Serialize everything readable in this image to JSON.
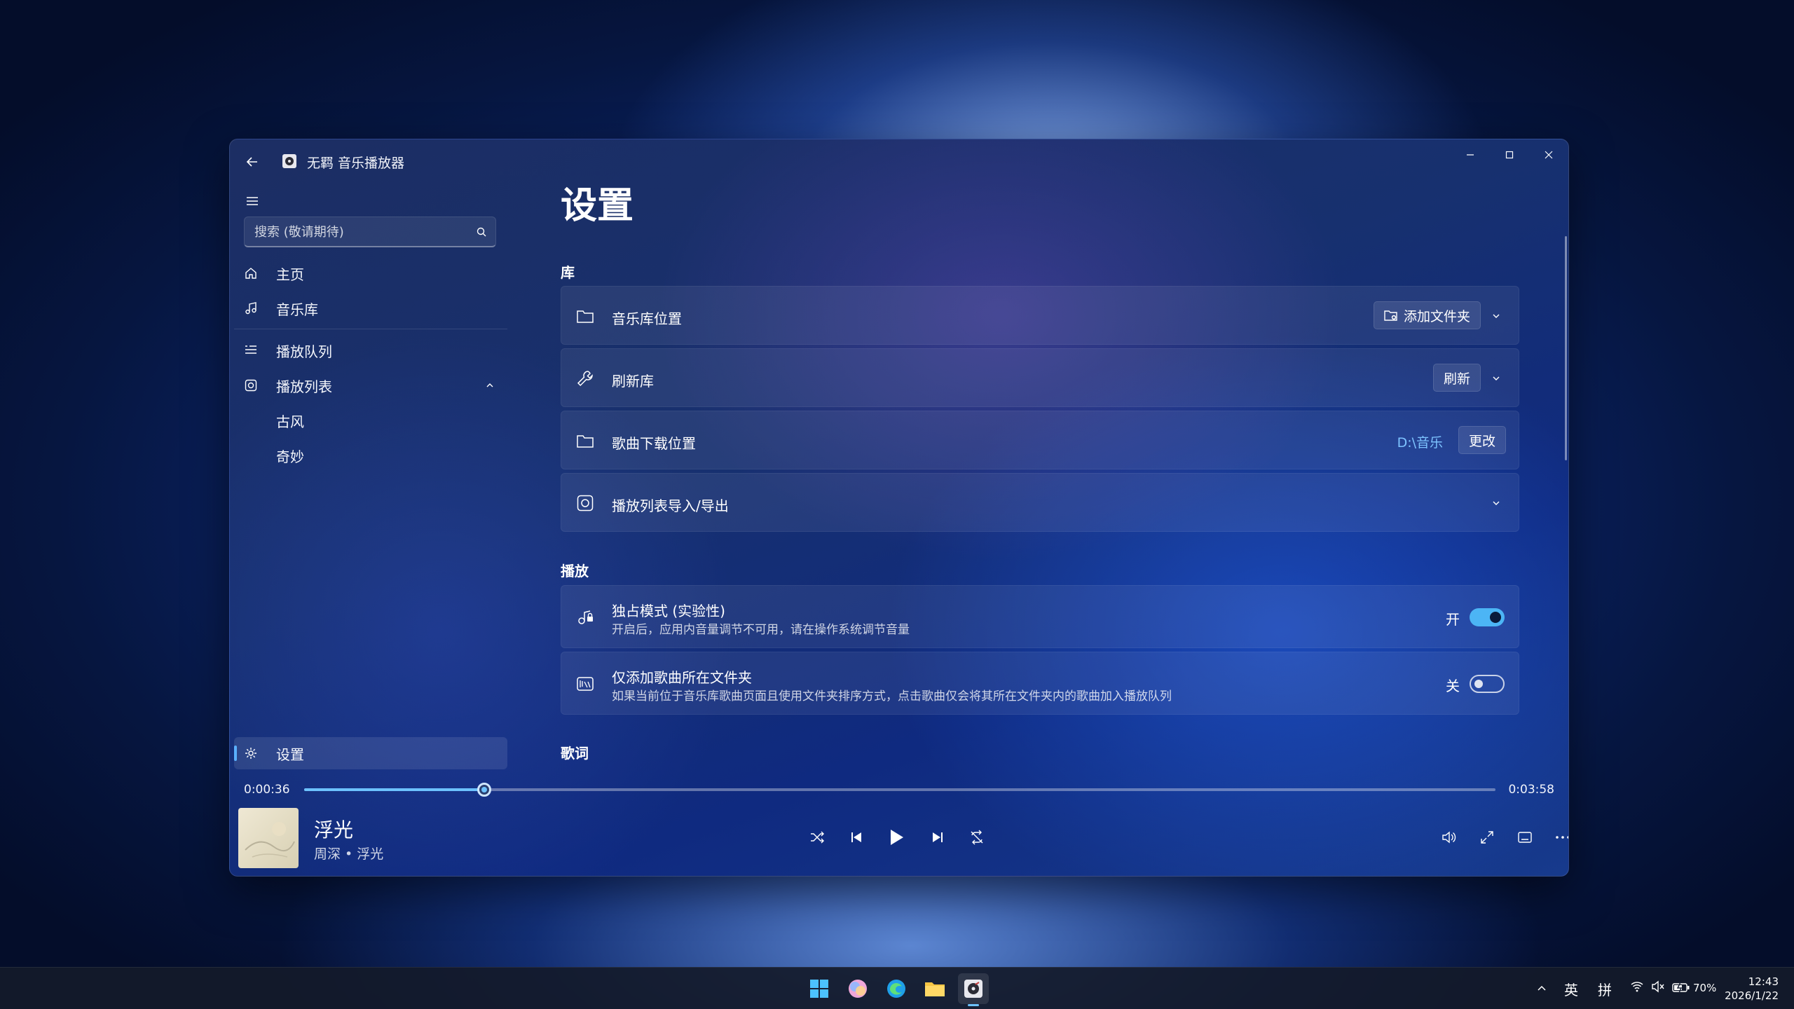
{
  "window": {
    "title": "无羁 音乐播放器"
  },
  "sidebar": {
    "search_placeholder": "搜索 (敬请期待)",
    "items": [
      {
        "label": "主页",
        "icon": "home-icon"
      },
      {
        "label": "音乐库",
        "icon": "music-note-icon"
      },
      {
        "label": "播放队列",
        "icon": "queue-icon"
      },
      {
        "label": "播放列表",
        "icon": "playlist-icon"
      },
      {
        "label": "古风"
      },
      {
        "label": "奇妙"
      }
    ],
    "settings_label": "设置"
  },
  "main": {
    "page_title": "设置",
    "sections": {
      "library": {
        "title": "库",
        "music_location": {
          "title": "音乐库位置",
          "button": "添加文件夹"
        },
        "refresh": {
          "title": "刷新库",
          "button": "刷新"
        },
        "download_location": {
          "title": "歌曲下载位置",
          "path": "D:\\音乐",
          "button": "更改"
        },
        "playlist_io": {
          "title": "播放列表导入/导出"
        }
      },
      "playback": {
        "title": "播放",
        "exclusive": {
          "title": "独占模式 (实验性)",
          "desc": "开启后，应用内音量调节不可用，请在操作系统调节音量",
          "state_label": "开",
          "enabled": true
        },
        "folder_only": {
          "title": "仅添加歌曲所在文件夹",
          "desc": "如果当前位于音乐库歌曲页面且使用文件夹排序方式，点击歌曲仅会将其所在文件夹内的歌曲加入播放队列",
          "state_label": "关",
          "enabled": false
        }
      },
      "lyrics": {
        "title": "歌词"
      }
    }
  },
  "player": {
    "current_time": "0:00:36",
    "total_time": "0:03:58",
    "progress_fraction": 0.1513,
    "song_title": "浮光",
    "song_artist": "周深 • 浮光",
    "accent_color": "#4cb5f5"
  },
  "taskbar": {
    "lang_en": "英",
    "lang_ime": "拼",
    "battery": "70%",
    "time": "12:43",
    "date": "2026/1/22"
  }
}
